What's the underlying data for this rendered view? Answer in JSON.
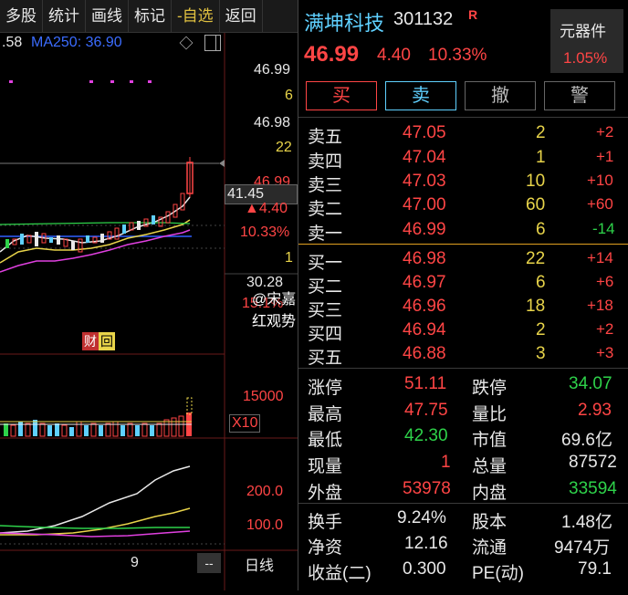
{
  "toolbar": {
    "items": [
      "多股",
      "统计",
      "画线",
      "标记",
      "-自选",
      "返回"
    ]
  },
  "chart": {
    "ma_prefix": ".58",
    "ma250_label": "MA250: 36.90",
    "price_ticks": [
      "46.99",
      "6",
      "46.98",
      "22",
      "46.99",
      "4.40",
      "10.33%",
      "1"
    ],
    "crosshair_price": "41.45",
    "low_ticks": [
      "30.28",
      "15.1%"
    ],
    "finance_badge": "财",
    "finance_badge2": "回",
    "volume_tick": "15000",
    "volume_mult": "X10",
    "macd_ticks": [
      "200.0",
      "100.0"
    ],
    "date_label": "9",
    "period_label": "日线",
    "dash_btn": "--",
    "watermark": "@宋嘉红观势"
  },
  "quote": {
    "name": "满坤科技",
    "code": "301132",
    "badge": "R",
    "sector": "元器件",
    "sector_change": "1.05%",
    "price": "46.99",
    "change": "4.40",
    "change_pct": "10.33%",
    "buttons": {
      "buy": "买",
      "sell": "卖",
      "cancel": "撤",
      "alert": "警"
    }
  },
  "order_book": {
    "asks": [
      {
        "label": "卖五",
        "price": "47.05",
        "vol": "2",
        "delta": "+2"
      },
      {
        "label": "卖四",
        "price": "47.04",
        "vol": "1",
        "delta": "+1"
      },
      {
        "label": "卖三",
        "price": "47.03",
        "vol": "10",
        "delta": "+10"
      },
      {
        "label": "卖二",
        "price": "47.00",
        "vol": "60",
        "delta": "+60"
      },
      {
        "label": "卖一",
        "price": "46.99",
        "vol": "6",
        "delta": "-14"
      }
    ],
    "bids": [
      {
        "label": "买一",
        "price": "46.98",
        "vol": "22",
        "delta": "+14"
      },
      {
        "label": "买二",
        "price": "46.97",
        "vol": "6",
        "delta": "+6"
      },
      {
        "label": "买三",
        "price": "46.96",
        "vol": "18",
        "delta": "+18"
      },
      {
        "label": "买四",
        "price": "46.94",
        "vol": "2",
        "delta": "+2"
      },
      {
        "label": "买五",
        "price": "46.88",
        "vol": "3",
        "delta": "+3"
      }
    ]
  },
  "stats": {
    "limit_up_label": "涨停",
    "limit_up": "51.11",
    "limit_down_label": "跌停",
    "limit_down": "34.07",
    "high_label": "最高",
    "high": "47.75",
    "vol_ratio_label": "量比",
    "vol_ratio": "2.93",
    "low_label": "最低",
    "low": "42.30",
    "mkt_cap_label": "市值",
    "mkt_cap": "69.6亿",
    "cur_vol_label": "现量",
    "cur_vol": "1",
    "total_vol_label": "总量",
    "total_vol": "87572",
    "outer_label": "外盘",
    "outer": "53978",
    "inner_label": "内盘",
    "inner": "33594",
    "turnover_label": "换手",
    "turnover": "9.24%",
    "shares_label": "股本",
    "shares": "1.48亿",
    "nav_label": "净资",
    "nav": "12.16",
    "float_label": "流通",
    "float": "9474万",
    "eps_label": "收益(二)",
    "eps": "0.300",
    "pe_label": "PE(动)",
    "pe": "79.1"
  },
  "colors": {
    "up": "#ff4545",
    "down": "#2ed24a",
    "accent": "#e8d44a",
    "name": "#5fd0ff"
  }
}
